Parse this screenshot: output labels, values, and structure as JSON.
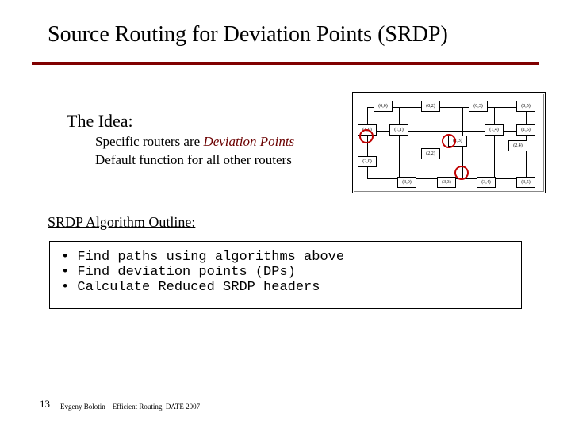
{
  "title": "Source Routing for Deviation Points (SRDP)",
  "idea": {
    "heading": "The Idea:",
    "line1_prefix": "Specific routers are ",
    "line1_em": "Deviation Points",
    "line2": "Default function for all other routers"
  },
  "diagram": {
    "nodes": [
      {
        "id": "(0,0)",
        "row": 0,
        "col": 0
      },
      {
        "id": "(0,2)",
        "row": 0,
        "col": 2
      },
      {
        "id": "(0,3)",
        "row": 0,
        "col": 3
      },
      {
        "id": "(0,5)",
        "row": 0,
        "col": 5
      },
      {
        "id": "(1,0)",
        "row": 1,
        "col": 0
      },
      {
        "id": "(1,1)",
        "row": 1,
        "col": 1
      },
      {
        "id": "(1,3)",
        "row": 1,
        "col": 3
      },
      {
        "id": "(1,4)",
        "row": 1,
        "col": 4
      },
      {
        "id": "(1,5)",
        "row": 1,
        "col": 5
      },
      {
        "id": "(2,0)",
        "row": 2,
        "col": 0
      },
      {
        "id": "(2,2)",
        "row": 2,
        "col": 2
      },
      {
        "id": "(2,4)",
        "row": 2,
        "col": 4
      },
      {
        "id": "(3,0)",
        "row": 3,
        "col": 0
      },
      {
        "id": "(3,3)",
        "row": 3,
        "col": 3
      },
      {
        "id": "(3,4)",
        "row": 3,
        "col": 4
      },
      {
        "id": "(3,5)",
        "row": 3,
        "col": 5
      }
    ],
    "deviation_points": [
      "(1,0)",
      "(1,3)",
      "(3,3)"
    ]
  },
  "outline": {
    "heading": "SRDP Algorithm Outline:",
    "items": [
      "Find paths using algorithms above",
      "Find deviation points (DPs)",
      "Calculate Reduced SRDP headers"
    ]
  },
  "footer": {
    "page": "13",
    "text": "Evgeny Bolotin – Efficient Routing, DATE 2007"
  }
}
